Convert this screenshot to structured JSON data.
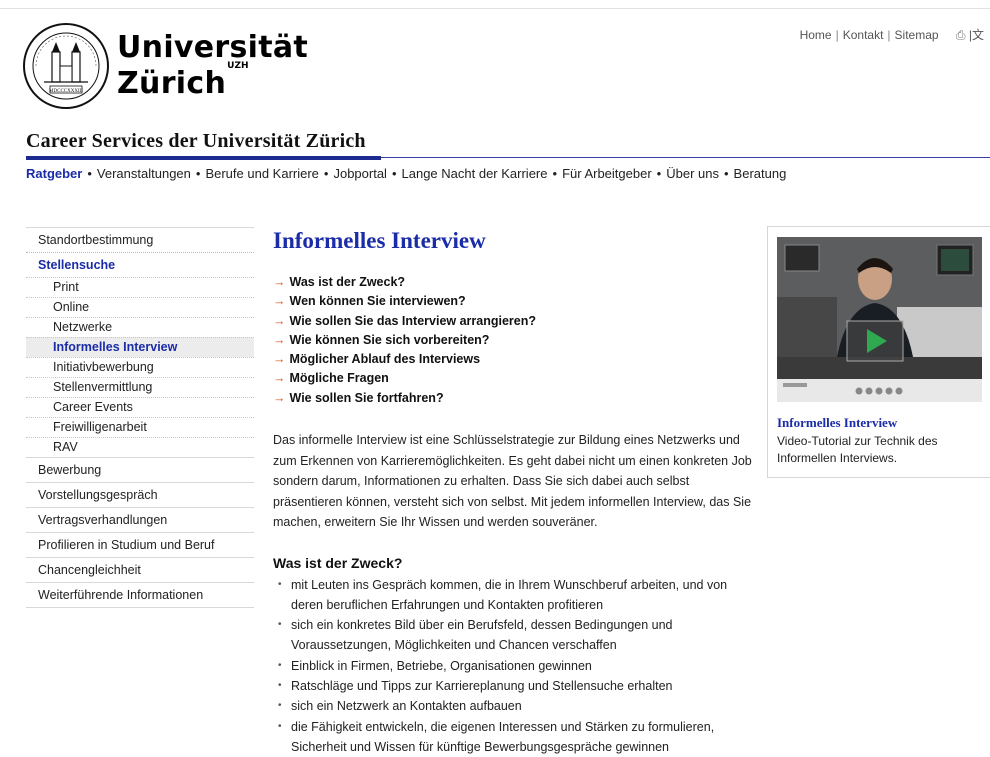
{
  "header": {
    "brand_line1": "Universität",
    "brand_line2": "Zürich",
    "brand_sup": "UZH",
    "topnav": [
      "Home",
      "Kontakt",
      "Sitemap"
    ],
    "print_icon": "⎙",
    "extra_icon": "|文",
    "seal_motto": "MDCCCXXXIII"
  },
  "section_title": "Career Services der Universität Zürich",
  "mainnav": [
    "Ratgeber",
    "Veranstaltungen",
    "Berufe und Karriere",
    "Jobportal",
    "Lange Nacht der Karriere",
    "Für Arbeitgeber",
    "Über uns",
    "Beratung"
  ],
  "sidebar": {
    "top": "Standortbestimmung",
    "active": "Stellensuche",
    "sub": [
      "Print",
      "Online",
      "Netzwerke",
      "Informelles Interview",
      "Initiativbewerbung",
      "Stellenvermittlung",
      "Career Events",
      "Freiwilligenarbeit",
      "RAV"
    ],
    "rest": [
      "Bewerbung",
      "Vorstellungsgespräch",
      "Vertragsverhandlungen",
      "Profilieren in Studium und Beruf",
      "Chancengleichheit",
      "Weiterführende Informationen"
    ]
  },
  "main": {
    "title": "Informelles Interview",
    "toc": [
      "Was ist der Zweck?",
      "Wen können Sie interviewen?",
      "Wie sollen Sie das Interview arrangieren?",
      "Wie können Sie sich vorbereiten?",
      "Möglicher Ablauf des Interviews",
      "Mögliche Fragen",
      "Wie sollen Sie fortfahren?"
    ],
    "intro_lines": [
      "Das informelle Interview ist eine Schlüsselstrategie zur Bildung eines Netzwerks und",
      "zum Erkennen von Karrieremöglichkeiten. Es geht dabei nicht um einen konkreten Job",
      "sondern darum, Informationen zu erhalten. Dass Sie sich dabei auch selbst",
      "präsentieren können, versteht sich von selbst. Mit jedem informellen Interview, das Sie",
      "machen, erweitern Sie Ihr Wissen und werden souveräner."
    ],
    "section_heading": "Was ist der Zweck?",
    "bullets": [
      [
        "mit Leuten ins Gespräch kommen, die in Ihrem Wunschberuf arbeiten, und von",
        "deren beruflichen Erfahrungen und Kontakten profitieren"
      ],
      [
        "sich ein konkretes Bild über ein Berufsfeld, dessen Bedingungen und",
        "Voraussetzungen, Möglichkeiten und Chancen verschaffen"
      ],
      [
        "Einblick in Firmen, Betriebe, Organisationen gewinnen"
      ],
      [
        "Ratschläge und Tipps zur Karriereplanung und Stellensuche erhalten"
      ],
      [
        "sich ein Netzwerk an Kontakten aufbauen"
      ],
      [
        "die Fähigkeit entwickeln, die eigenen Interessen und Stärken zu formulieren,",
        "Sicherheit und Wissen für künftige Bewerbungsgespräche gewinnen"
      ]
    ]
  },
  "sidebox": {
    "video_title": "Informelles Interview",
    "video_desc": "Video-Tutorial zur Technik des Informellen Interviews.",
    "colors": {
      "accent": "#1b2ca8",
      "play": "#2fa84f"
    }
  }
}
